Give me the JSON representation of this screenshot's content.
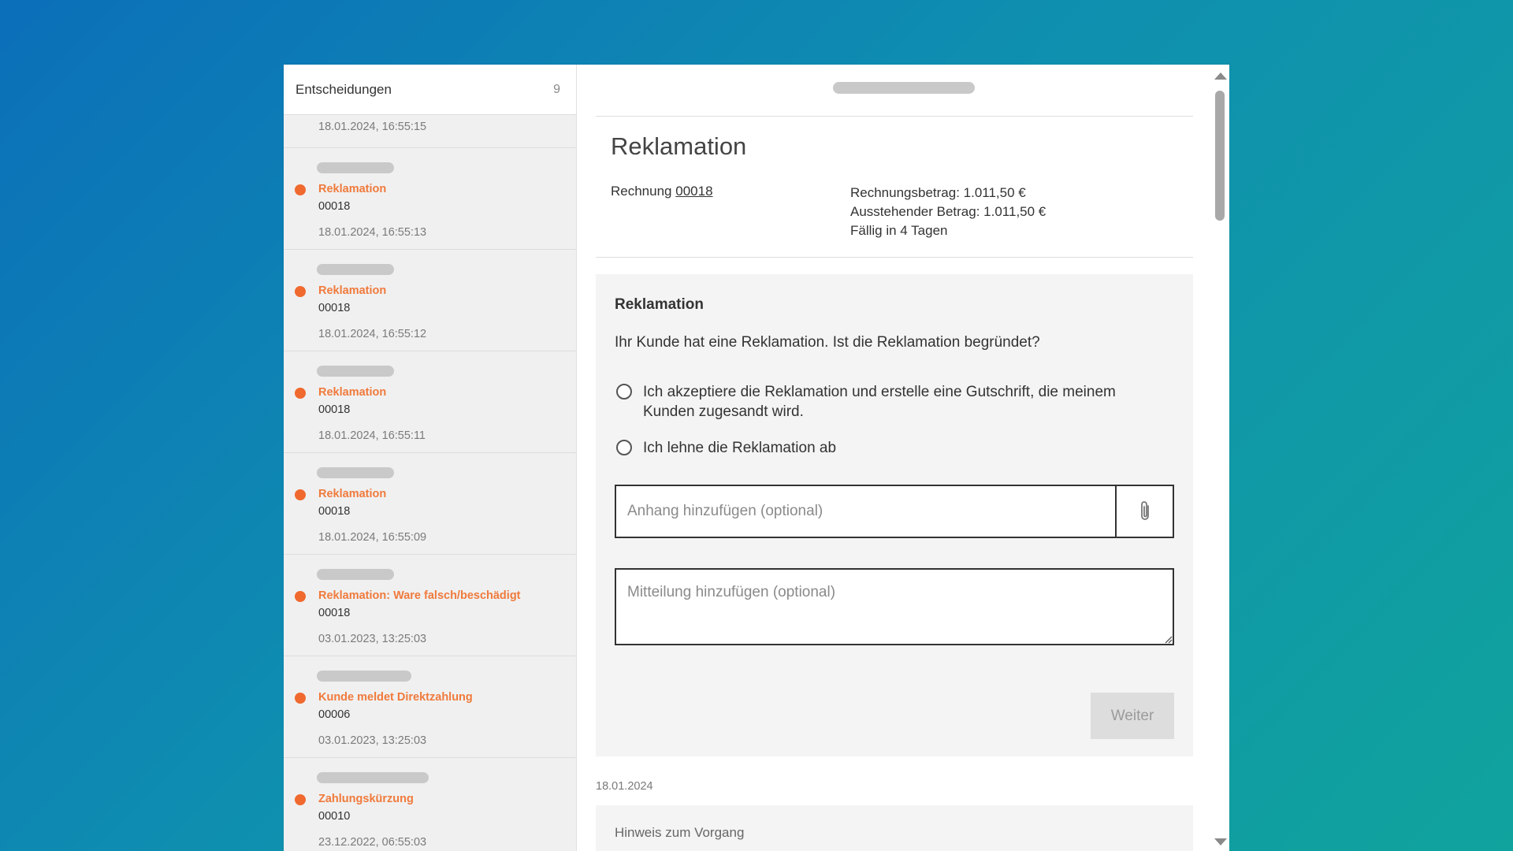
{
  "sidebar": {
    "header_title": "Entscheidungen",
    "header_count": "9",
    "partial_item_time": "18.01.2024, 16:55:15",
    "items": [
      {
        "title": "Reklamation",
        "invoice": "00018",
        "time": "18.01.2024, 16:55:13"
      },
      {
        "title": "Reklamation",
        "invoice": "00018",
        "time": "18.01.2024, 16:55:12"
      },
      {
        "title": "Reklamation",
        "invoice": "00018",
        "time": "18.01.2024, 16:55:11"
      },
      {
        "title": "Reklamation",
        "invoice": "00018",
        "time": "18.01.2024, 16:55:09"
      },
      {
        "title": "Reklamation: Ware falsch/beschädigt",
        "invoice": "00018",
        "time": "03.01.2023, 13:25:03"
      },
      {
        "title": "Kunde meldet Direktzahlung",
        "invoice": "00006",
        "time": "03.01.2023, 13:25:03"
      },
      {
        "title": "Zahlungskürzung",
        "invoice": "00010",
        "time": "23.12.2022, 06:55:03"
      }
    ]
  },
  "content": {
    "title": "Reklamation",
    "invoice_label": "Rechnung",
    "invoice_number": "00018",
    "amount": "Rechnungsbetrag: 1.011,50 €",
    "outstanding": "Ausstehender Betrag: 1.011,50 €",
    "due": "Fällig in 4 Tagen",
    "form": {
      "heading": "Reklamation",
      "question": "Ihr Kunde hat eine Reklamation. Ist die Reklamation begründet?",
      "option_accept": "Ich akzeptiere die Reklamation und erstelle eine Gutschrift, die meinem Kunden zugesandt wird.",
      "option_reject": "Ich lehne die Reklamation ab",
      "attachment_placeholder": "Anhang hinzufügen (optional)",
      "message_placeholder": "Mitteilung hinzufügen (optional)",
      "next_label": "Weiter"
    },
    "history_date": "18.01.2024",
    "note_title": "Hinweis zum Vorgang"
  },
  "colors": {
    "accent_orange": "#f07a3c",
    "status_dot": "#f0692e",
    "background_gradient_start": "#0b6fb9",
    "background_gradient_end": "#10a39d"
  },
  "icons": {
    "attachment": "paperclip-icon",
    "status": "status-dot-icon",
    "scroll_up": "arrow-up-icon",
    "scroll_down": "arrow-down-icon"
  }
}
